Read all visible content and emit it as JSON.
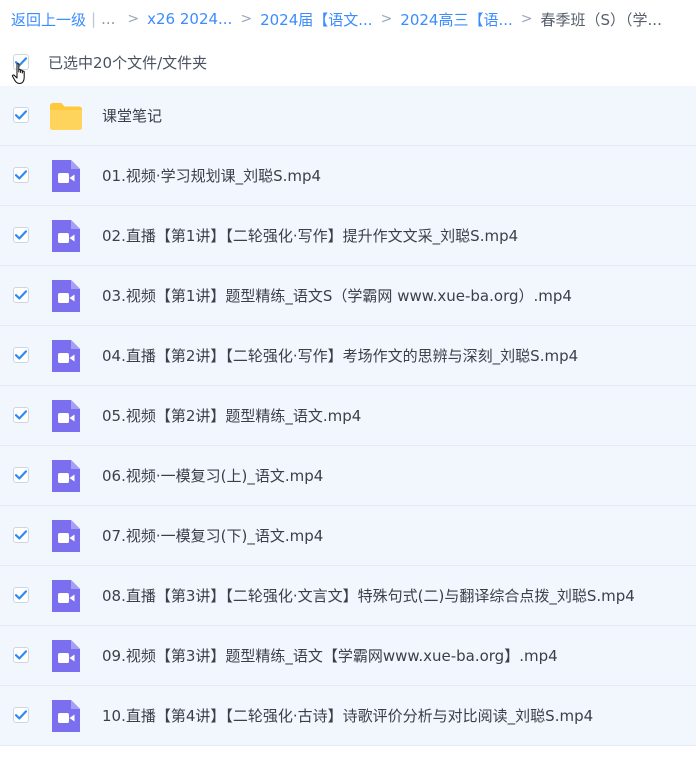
{
  "breadcrumb": {
    "back": "返回上一级",
    "sep_bar": "|",
    "dots": "...",
    "items": [
      "x26 2024...",
      "2024届【语文...",
      "2024高三【语...",
      "春季班（S）（学..."
    ],
    "chevron": ">"
  },
  "selection": {
    "label": "已选中20个文件/文件夹"
  },
  "colors": {
    "accent": "#3b8cff",
    "checkbox_blue": "#2e8cf0",
    "video_icon": "#7b6ff0",
    "folder": "#ffc83d",
    "row_bg": "#f2f7fe"
  },
  "files": [
    {
      "name": "课堂笔记",
      "type": "folder",
      "icon": "folder-icon"
    },
    {
      "name": "01.视频·学习规划课_刘聪S.mp4",
      "type": "video",
      "icon": "video-icon"
    },
    {
      "name": "02.直播【第1讲】【二轮强化·写作】提升作文文采_刘聪S.mp4",
      "type": "video",
      "icon": "video-icon"
    },
    {
      "name": "03.视频【第1讲】题型精练_语文S（学霸网 www.xue-ba.org）.mp4",
      "type": "video",
      "icon": "video-icon"
    },
    {
      "name": "04.直播【第2讲】【二轮强化·写作】考场作文的思辨与深刻_刘聪S.mp4",
      "type": "video",
      "icon": "video-icon"
    },
    {
      "name": "05.视频【第2讲】题型精练_语文.mp4",
      "type": "video",
      "icon": "video-icon"
    },
    {
      "name": "06.视频·一模复习(上)_语文.mp4",
      "type": "video",
      "icon": "video-icon"
    },
    {
      "name": "07.视频·一模复习(下)_语文.mp4",
      "type": "video",
      "icon": "video-icon"
    },
    {
      "name": "08.直播【第3讲】【二轮强化·文言文】特殊句式(二)与翻译综合点拨_刘聪S.mp4",
      "type": "video",
      "icon": "video-icon"
    },
    {
      "name": "09.视频【第3讲】题型精练_语文【学霸网www.xue-ba.org】.mp4",
      "type": "video",
      "icon": "video-icon"
    },
    {
      "name": "10.直播【第4讲】【二轮强化·古诗】诗歌评价分析与对比阅读_刘聪S.mp4",
      "type": "video",
      "icon": "video-icon"
    }
  ]
}
